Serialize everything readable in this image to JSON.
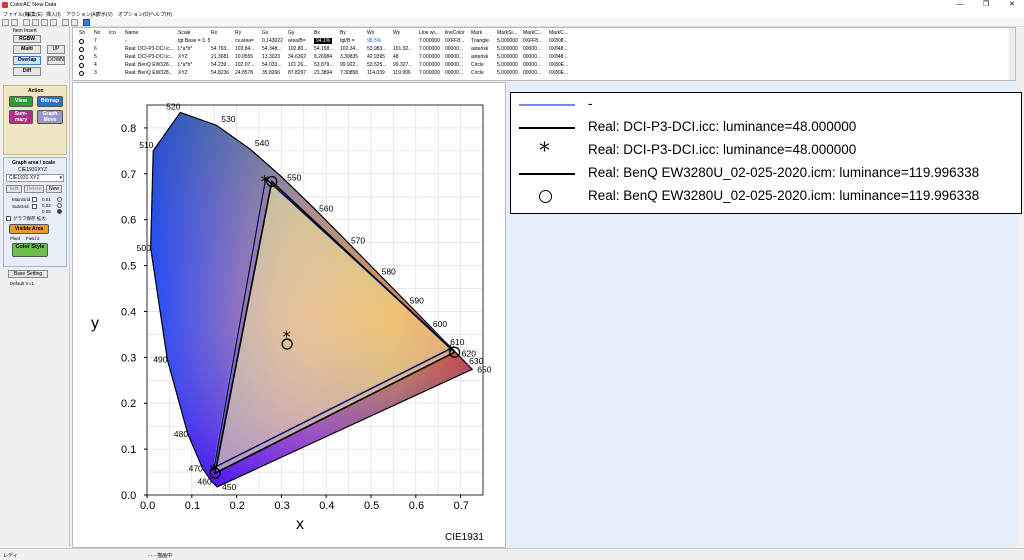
{
  "window": {
    "title": "ColorAC New Data",
    "minimize": "—",
    "maximize": "❐",
    "close": "✕"
  },
  "menu": [
    "ファイル(F)",
    "編集(E)",
    "挿入(I)",
    "アクション(A)",
    "表示(V)",
    "オプション(O)",
    "ヘルプ(H)"
  ],
  "item_insert": {
    "label": "Item Insert",
    "rgbw": "RGBW",
    "multi": "Multi",
    "up": "UP",
    "overlap": "Overlap",
    "down": "DOWN",
    "diff": "Diff"
  },
  "action": {
    "label": "Action",
    "view": "View",
    "bitmap": "Bitmap",
    "summary": "Sum-mary",
    "graph_move": "Graph Move"
  },
  "graph_area": {
    "label": "Graph area / scale",
    "scale": "CIE1931XYZ",
    "select": "CIE1931 XYZ",
    "edit": "Edit",
    "delete": "Delete",
    "new": "New",
    "main_grid": "MainGrid",
    "sub_grid": "SubGrid",
    "grid_values": [
      "0.01",
      "0.02",
      "0.05"
    ],
    "keep_graph": "グラフ保存 拡大",
    "visible_area": "Visible Area",
    "planl": "Planl",
    "field": "Field 2",
    "color_style": "Color Style",
    "base_setting": "Base Setting",
    "default": "Default V=1"
  },
  "table": {
    "headers": [
      "Sh",
      "No",
      "Ico",
      "Name",
      "Scale",
      "Rx",
      "Ry",
      "Gx",
      "Gy",
      "Bx",
      "By",
      "Wx",
      "Wy",
      "Line wi...",
      "lineColor",
      "Mark",
      "MarkSi...",
      "MarkC...",
      "MarkC..."
    ],
    "rows": [
      [
        "",
        "7",
        "",
        "-",
        "tgt.Base = 3. 5",
        "",
        "cv.area=",
        "0.143022",
        "area/B=",
        "94.1%",
        "tgt/B =",
        "98.5%",
        "",
        "7.000000",
        "0XFF8...",
        "Triangle",
        "5.000000",
        "0XFF8...",
        "0X808..."
      ],
      [
        "",
        "6",
        "",
        "Real: DCI-P3-DCI.ic...",
        "L*a*b*",
        "54.763...",
        "103.84...",
        "54.348...",
        "102.80...",
        "54.158...",
        "102.34...",
        "53.983...",
        "101.92...",
        "7.000000",
        "00000...",
        "asterisk",
        "5.000000",
        "00000...",
        "0X848..."
      ],
      [
        "",
        "5",
        "",
        "Real: DCI-P3-DCI.ic...",
        "XYZ",
        "21.3681",
        "10.0555",
        "13.3023",
        "34.6362",
        "8.26984",
        "3.30835",
        "42.9395",
        "48",
        "7.000000",
        "00000...",
        "asterisk",
        "5.000000",
        "00000...",
        "0X848..."
      ],
      [
        "",
        "4",
        "",
        "Real: BenQ EW328...",
        "L*a*b*",
        "54.239...",
        "102.07...",
        "54.033...",
        "101.26...",
        "53.879...",
        "99.922...",
        "53.525...",
        "99.327...",
        "7.000000",
        "00000...",
        "Circle",
        "5.000000",
        "00000...",
        "0X80E..."
      ],
      [
        "",
        "3",
        "",
        "Real: BenQ EW328...",
        "XYZ",
        "54.8236",
        "24.8578",
        "35.8266",
        "87.8297",
        "23.3894",
        "7.30858",
        "114.039",
        "119.996",
        "7.000000",
        "00000...",
        "Circle",
        "5.000000",
        "00000...",
        "0X80E..."
      ]
    ]
  },
  "chart_data": {
    "type": "scatter",
    "title": "",
    "watermark": "CIE1931",
    "xlabel": "x",
    "ylabel": "y",
    "xlim": [
      0.0,
      0.75
    ],
    "ylim": [
      0.0,
      0.85
    ],
    "xticks": [
      "0.0",
      "0.1",
      "0.2",
      "0.3",
      "0.4",
      "0.5",
      "0.6",
      "0.7"
    ],
    "yticks": [
      "0.0",
      "0.1",
      "0.2",
      "0.3",
      "0.4",
      "0.5",
      "0.6",
      "0.7",
      "0.8"
    ],
    "spectral_locus": [
      {
        "nm": "450",
        "x": 0.1566,
        "y": 0.0177
      },
      {
        "nm": "460",
        "x": 0.144,
        "y": 0.0297
      },
      {
        "nm": "470",
        "x": 0.1241,
        "y": 0.0578
      },
      {
        "nm": "480",
        "x": 0.0913,
        "y": 0.1327
      },
      {
        "nm": "490",
        "x": 0.0454,
        "y": 0.295
      },
      {
        "nm": "500",
        "x": 0.0082,
        "y": 0.5384
      },
      {
        "nm": "510",
        "x": 0.0139,
        "y": 0.7502
      },
      {
        "nm": "520",
        "x": 0.0743,
        "y": 0.8338
      },
      {
        "nm": "530",
        "x": 0.1547,
        "y": 0.8059
      },
      {
        "nm": "540",
        "x": 0.2296,
        "y": 0.7543
      },
      {
        "nm": "550",
        "x": 0.3016,
        "y": 0.6923
      },
      {
        "nm": "560",
        "x": 0.3731,
        "y": 0.6245
      },
      {
        "nm": "570",
        "x": 0.4441,
        "y": 0.5547
      },
      {
        "nm": "580",
        "x": 0.5125,
        "y": 0.4866
      },
      {
        "nm": "590",
        "x": 0.5752,
        "y": 0.4242
      },
      {
        "nm": "600",
        "x": 0.627,
        "y": 0.3725
      },
      {
        "nm": "610",
        "x": 0.6658,
        "y": 0.334
      },
      {
        "nm": "620",
        "x": 0.6915,
        "y": 0.3083
      },
      {
        "nm": "630",
        "x": 0.7079,
        "y": 0.292
      },
      {
        "nm": "650",
        "x": 0.726,
        "y": 0.274
      }
    ],
    "series": [
      {
        "name": "-",
        "color": "#8080ff",
        "points": [
          [
            0.68,
            0.32
          ],
          [
            0.265,
            0.69
          ],
          [
            0.15,
            0.06
          ]
        ]
      },
      {
        "name": "Real: DCI-P3-DCI.icc: luminance=48.000000",
        "color": "#000000",
        "marker": "asterisk",
        "points": [
          [
            0.68,
            0.32
          ],
          [
            0.265,
            0.69
          ],
          [
            0.15,
            0.06
          ],
          [
            0.314,
            0.351
          ]
        ]
      },
      {
        "name": "Real: BenQ EW3280U_02-025-2020.icm: luminance=119.996338",
        "color": "#000000",
        "marker": "circle",
        "points": [
          [
            0.6865,
            0.3112
          ],
          [
            0.2786,
            0.6832
          ],
          [
            0.152,
            0.0475
          ],
          [
            0.3127,
            0.329
          ]
        ]
      }
    ]
  },
  "legend": [
    {
      "text": "-",
      "type": "line",
      "color": "#8080ff"
    },
    {
      "text": "Real: DCI-P3-DCI.icc: luminance=48.000000",
      "type": "line",
      "color": "#000000"
    },
    {
      "text": "Real: DCI-P3-DCI.icc: luminance=48.000000",
      "type": "asterisk",
      "color": "#000000"
    },
    {
      "text": "Real: BenQ EW3280U_02-025-2020.icm: luminance=119.996338",
      "type": "line",
      "color": "#000000"
    },
    {
      "text": "Real: BenQ EW3280U_02-025-2020.icm: luminance=119.996338",
      "type": "circle",
      "color": "#000000"
    }
  ],
  "status": {
    "left": "レディ",
    "mid": "- - - 描画中"
  }
}
